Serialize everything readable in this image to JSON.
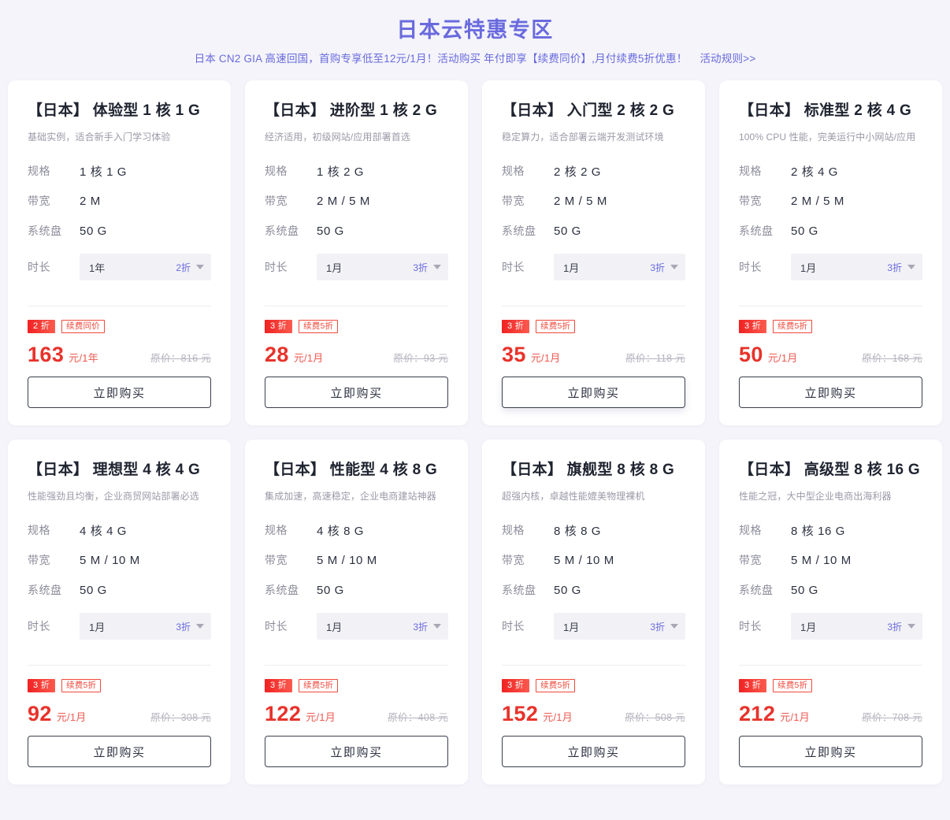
{
  "header": {
    "title": "日本云特惠专区",
    "subtitle": "日本 CN2 GIA 高速回国，首购专享低至12元/1月！活动购买 年付即享【续费同价】,月付续费5折优惠！",
    "rules_link": "活动规则>>",
    "title_color": "#6a6ade"
  },
  "labels": {
    "spec": "规格",
    "bandwidth": "带宽",
    "disk": "系统盘",
    "duration": "时长",
    "buy": "立即购买",
    "original_prefix": "原价："
  },
  "colors": {
    "accent": "#6a6ade",
    "price": "#e7332b",
    "badge_red": "#f02222",
    "page_bg": "#f4f4fa",
    "card_bg": "#ffffff"
  },
  "cards": [
    {
      "title": "【日本】 体验型 1 核 1 G",
      "desc": "基础实例，适合新手入门学习体验",
      "spec": "1 核 1 G",
      "bandwidth": "2 M",
      "disk": "50 G",
      "duration_value": "1年",
      "duration_discount": "2折",
      "badge_discount": "2 折",
      "badge_renew": "续费同价",
      "price": "163",
      "price_unit": "元/1年",
      "original_price": "原价：816 元",
      "buy": "立即购买",
      "hovered": false
    },
    {
      "title": "【日本】 进阶型 1 核 2 G",
      "desc": "经济适用，初级网站/应用部署首选",
      "spec": "1 核 2 G",
      "bandwidth": "2 M / 5 M",
      "disk": "50 G",
      "duration_value": "1月",
      "duration_discount": "3折",
      "badge_discount": "3 折",
      "badge_renew": "续费5折",
      "price": "28",
      "price_unit": "元/1月",
      "original_price": "原价：93 元",
      "buy": "立即购买",
      "hovered": false
    },
    {
      "title": "【日本】 入门型 2 核 2 G",
      "desc": "稳定算力，适合部署云端开发测试环境",
      "spec": "2 核 2 G",
      "bandwidth": "2 M / 5 M",
      "disk": "50 G",
      "duration_value": "1月",
      "duration_discount": "3折",
      "badge_discount": "3 折",
      "badge_renew": "续费5折",
      "price": "35",
      "price_unit": "元/1月",
      "original_price": "原价：118 元",
      "buy": "立即购买",
      "hovered": true
    },
    {
      "title": "【日本】 标准型 2 核 4 G",
      "desc": "100% CPU 性能，完美运行中小网站/应用",
      "spec": "2 核 4 G",
      "bandwidth": "2 M / 5 M",
      "disk": "50 G",
      "duration_value": "1月",
      "duration_discount": "3折",
      "badge_discount": "3 折",
      "badge_renew": "续费5折",
      "price": "50",
      "price_unit": "元/1月",
      "original_price": "原价：168 元",
      "buy": "立即购买",
      "hovered": false
    },
    {
      "title": "【日本】 理想型 4 核 4 G",
      "desc": "性能强劲且均衡，企业商贸网站部署必选",
      "spec": "4 核 4 G",
      "bandwidth": "5 M / 10 M",
      "disk": "50 G",
      "duration_value": "1月",
      "duration_discount": "3折",
      "badge_discount": "3 折",
      "badge_renew": "续费5折",
      "price": "92",
      "price_unit": "元/1月",
      "original_price": "原价：308 元",
      "buy": "立即购买",
      "hovered": false
    },
    {
      "title": "【日本】 性能型 4 核 8 G",
      "desc": "集成加速，高速稳定，企业电商建站神器",
      "spec": "4 核 8 G",
      "bandwidth": "5 M / 10 M",
      "disk": "50 G",
      "duration_value": "1月",
      "duration_discount": "3折",
      "badge_discount": "3 折",
      "badge_renew": "续费5折",
      "price": "122",
      "price_unit": "元/1月",
      "original_price": "原价：408 元",
      "buy": "立即购买",
      "hovered": false
    },
    {
      "title": "【日本】 旗舰型 8 核 8 G",
      "desc": "超强内核，卓越性能媲美物理裸机",
      "spec": "8 核 8 G",
      "bandwidth": "5 M / 10 M",
      "disk": "50 G",
      "duration_value": "1月",
      "duration_discount": "3折",
      "badge_discount": "3 折",
      "badge_renew": "续费5折",
      "price": "152",
      "price_unit": "元/1月",
      "original_price": "原价：508 元",
      "buy": "立即购买",
      "hovered": false
    },
    {
      "title": "【日本】 高级型 8 核 16 G",
      "desc": "性能之冠，大中型企业电商出海利器",
      "spec": "8 核 16 G",
      "bandwidth": "5 M / 10 M",
      "disk": "50 G",
      "duration_value": "1月",
      "duration_discount": "3折",
      "badge_discount": "3 折",
      "badge_renew": "续费5折",
      "price": "212",
      "price_unit": "元/1月",
      "original_price": "原价：708 元",
      "buy": "立即购买",
      "hovered": false
    }
  ]
}
